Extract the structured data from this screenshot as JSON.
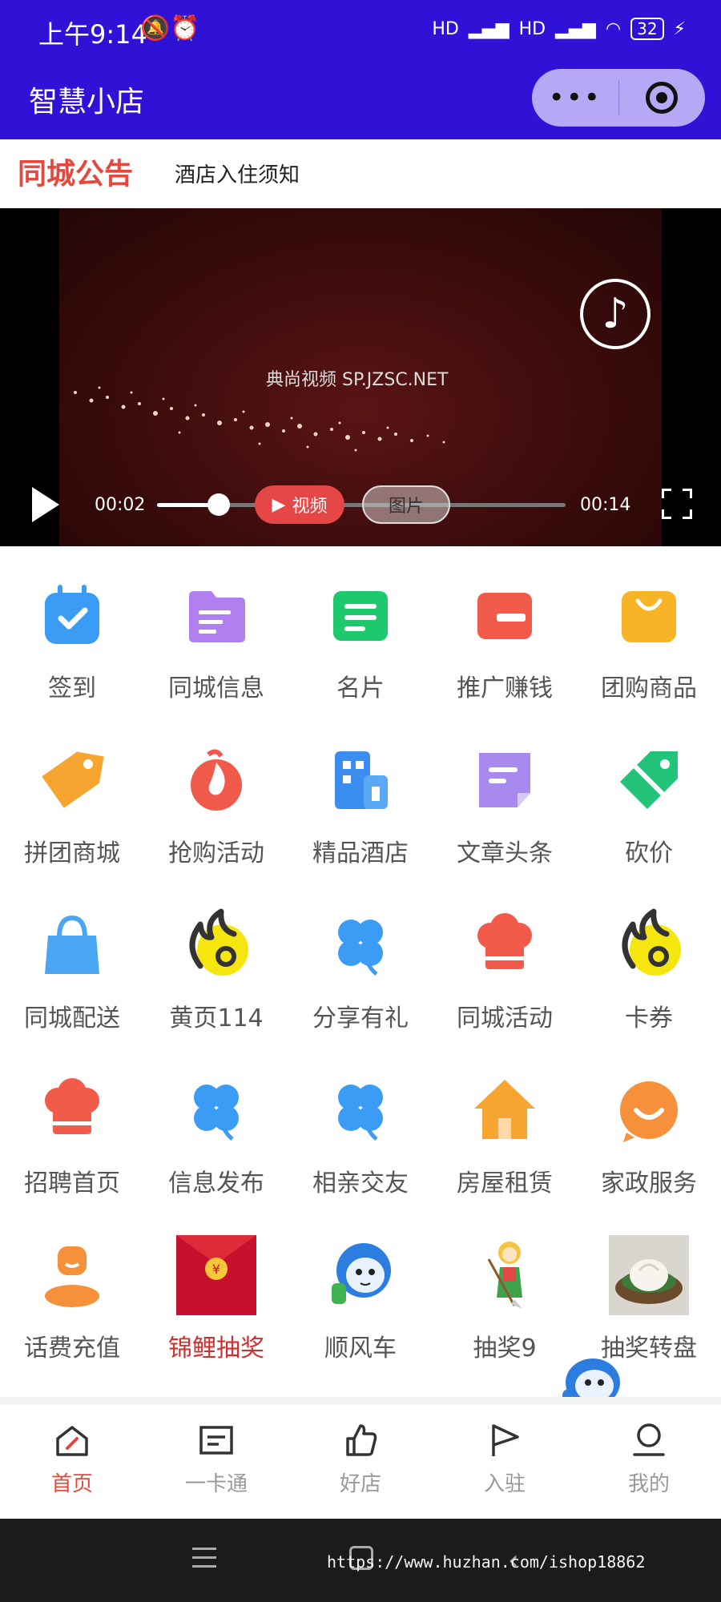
{
  "status_bar": {
    "time": "上午9:14",
    "battery": "32",
    "network": "HD"
  },
  "app": {
    "title": "智慧小店",
    "capsule_more": "•••"
  },
  "notice": {
    "tag": "同城公告",
    "text": "酒店入住须知"
  },
  "video": {
    "watermark": "典尚视频 SP.JZSC.NET",
    "current_time": "00:02",
    "total_time": "00:14",
    "progress": 0.15,
    "tab_video": "视频",
    "tab_image": "图片"
  },
  "grid": {
    "items": [
      {
        "label": "签到",
        "icon": "calendar-check-icon",
        "color": "#3b9cf5"
      },
      {
        "label": "同城信息",
        "icon": "folder-icon",
        "color": "#b07ff0"
      },
      {
        "label": "名片",
        "icon": "card-icon",
        "color": "#1ec86d"
      },
      {
        "label": "推广赚钱",
        "icon": "promo-icon",
        "color": "#f25b4a"
      },
      {
        "label": "团购商品",
        "icon": "shopping-bag-icon",
        "color": "#f8b427"
      },
      {
        "label": "拼团商城",
        "icon": "price-tag-icon",
        "color": "#f6a530"
      },
      {
        "label": "抢购活动",
        "icon": "flame-icon",
        "color": "#f05a4a"
      },
      {
        "label": "精品酒店",
        "icon": "building-icon",
        "color": "#3b8ef0"
      },
      {
        "label": "文章头条",
        "icon": "article-icon",
        "color": "#a889ee"
      },
      {
        "label": "砍价",
        "icon": "discount-tag-icon",
        "color": "#22c47a"
      },
      {
        "label": "同城配送",
        "icon": "handbag-icon",
        "color": "#4aa6f2"
      },
      {
        "label": "黄页114",
        "icon": "hot-coin-icon",
        "color": "#f5e60f"
      },
      {
        "label": "分享有礼",
        "icon": "clover-icon",
        "color": "#3b9cf5"
      },
      {
        "label": "同城活动",
        "icon": "chef-hat-icon",
        "color": "#f25b4a"
      },
      {
        "label": "卡券",
        "icon": "hot-coin-icon",
        "color": "#f5e60f"
      },
      {
        "label": "招聘首页",
        "icon": "chef-hat-icon",
        "color": "#f25b4a"
      },
      {
        "label": "信息发布",
        "icon": "clover-icon",
        "color": "#3b9cf5"
      },
      {
        "label": "相亲交友",
        "icon": "clover-icon",
        "color": "#3b9cf5"
      },
      {
        "label": "房屋租赁",
        "icon": "house-icon",
        "color": "#f6a530"
      },
      {
        "label": "家政服务",
        "icon": "smile-chat-icon",
        "color": "#f6903a"
      },
      {
        "label": "话费充值",
        "icon": "user-icon",
        "color": "#f6903a"
      },
      {
        "label": "锦鲤抽奖",
        "icon": "red-envelope-image",
        "color": "#d42d2d"
      },
      {
        "label": "顺风车",
        "icon": "mascot-image",
        "color": "#3b9cf5"
      },
      {
        "label": "抽奖9",
        "icon": "girl-sweeping-image",
        "color": "#f5c542"
      },
      {
        "label": "抽奖转盘",
        "icon": "dumpling-image",
        "color": "#b08a60"
      }
    ]
  },
  "tabbar": {
    "items": [
      {
        "label": "首页",
        "icon": "home-icon"
      },
      {
        "label": "一卡通",
        "icon": "card-list-icon"
      },
      {
        "label": "好店",
        "icon": "thumbs-up-icon"
      },
      {
        "label": "入驻",
        "icon": "flag-icon"
      },
      {
        "label": "我的",
        "icon": "profile-icon"
      }
    ],
    "active_index": 0
  },
  "system_nav": {
    "watermark": "https://www.huzhan.com/ishop18862"
  },
  "colors": {
    "header": "#2f12d6",
    "accent": "#e5483e"
  }
}
